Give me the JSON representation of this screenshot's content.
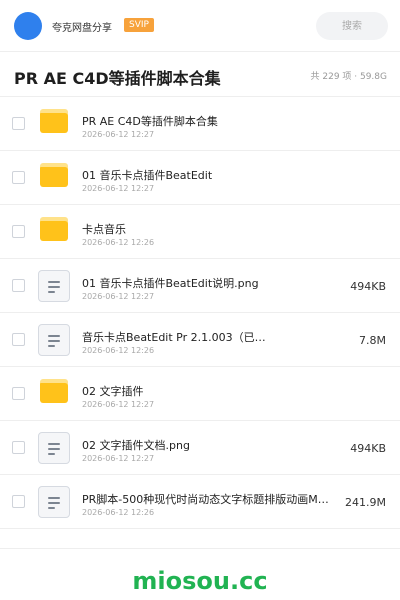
{
  "header": {
    "brand": "夸克网盘分享",
    "badge": "SVIP",
    "search_placeholder": "搜索"
  },
  "share": {
    "title": "PR AE C4D等插件脚本合集",
    "summary": "共 229 项 · 59.8G"
  },
  "files": [
    {
      "type": "folder",
      "name": "PR AE C4D等插件脚本合集",
      "date": "2026-06-12 12:27",
      "size": ""
    },
    {
      "type": "folder",
      "name": "01 音乐卡点插件BeatEdit",
      "date": "2026-06-12 12:27",
      "size": ""
    },
    {
      "type": "folder",
      "name": "卡点音乐",
      "date": "2026-06-12 12:26",
      "size": ""
    },
    {
      "type": "document",
      "name": "01 音乐卡点插件BeatEdit说明.png",
      "date": "2026-06-12 12:27",
      "size": "494KB"
    },
    {
      "type": "document",
      "name": "音乐卡点BeatEdit Pr 2.1.003（已…",
      "date": "2026-06-12 12:26",
      "size": "7.8M"
    },
    {
      "type": "folder",
      "name": "02 文字插件",
      "date": "2026-06-12 12:27",
      "size": ""
    },
    {
      "type": "document",
      "name": "02 文字插件文档.png",
      "date": "2026-06-12 12:27",
      "size": "494KB"
    },
    {
      "type": "document",
      "name": "PR脚本-500种现代时尚动态文字标题排版动画Mo…",
      "date": "2026-06-12 12:26",
      "size": "241.9M"
    }
  ],
  "watermark": "miosou.cc",
  "colors": {
    "accent": "#2f80ed",
    "badge": "#f7a23b",
    "folder": "#ffc21a",
    "watermark": "#21b352"
  }
}
